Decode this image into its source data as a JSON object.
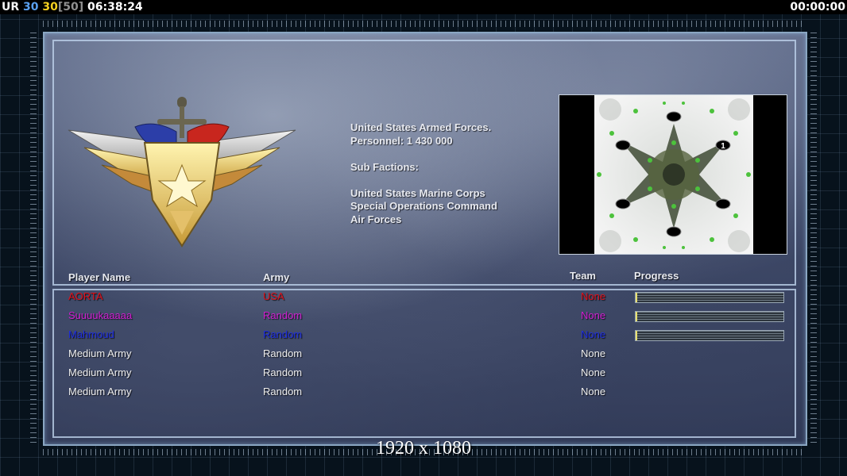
{
  "hud": {
    "label": "UR",
    "value_a": "30",
    "value_b": "30",
    "value_cap": "[50]",
    "clock": "06:38:24",
    "timer": "00:00:00"
  },
  "faction": {
    "name": "United States Armed Forces.",
    "personnel": "Personnel: 1 430 000",
    "sub_factions_label": "Sub Factions:",
    "sub_factions": [
      "United States Marine Corps",
      "Special Operations Command",
      "Air Forces"
    ]
  },
  "minimap": {
    "start_marker_label": "1"
  },
  "table": {
    "headers": {
      "player": "Player Name",
      "army": "Army",
      "team": "Team",
      "progress": "Progress"
    },
    "rows": [
      {
        "name": "AORTA",
        "army": "USA",
        "team": "None",
        "color": "#e0101a",
        "progress": 0.01
      },
      {
        "name": "Suuuukaaaaa",
        "army": "Random",
        "team": "None",
        "color": "#d21ed2",
        "progress": 0.01
      },
      {
        "name": "Mahmoud",
        "army": "Random",
        "team": "None",
        "color": "#1e2ee0",
        "progress": 0.01
      },
      {
        "name": "Medium Army",
        "army": "Random",
        "team": "None",
        "color": "#f0f0f0"
      },
      {
        "name": "Medium Army",
        "army": "Random",
        "team": "None",
        "color": "#f0f0f0"
      },
      {
        "name": "Medium Army",
        "army": "Random",
        "team": "None",
        "color": "#f0f0f0"
      }
    ]
  },
  "resolution": "1920 x 1080",
  "colors": {
    "hud_label": "#f5f5f5",
    "hud_value_a": "#5aa0f0",
    "hud_value_b": "#f5d020",
    "hud_cap": "#909090",
    "hud_clock": "#ffffff"
  }
}
